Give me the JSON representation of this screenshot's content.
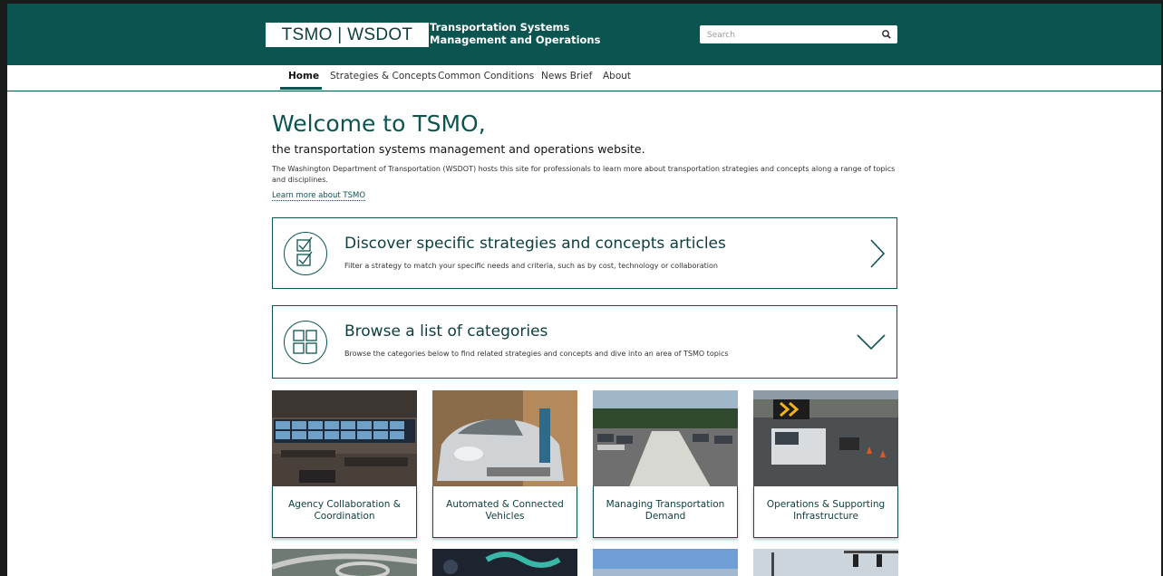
{
  "header": {
    "logo_text": "TSMO | WSDOT",
    "site_title_line1": "Transportation Systems",
    "site_title_line2": "Management and Operations",
    "search_placeholder": "Search",
    "brand_color": "#0c5450"
  },
  "nav": {
    "items": [
      {
        "label": "Home",
        "active": true
      },
      {
        "label": "Strategies & Concepts",
        "active": false
      },
      {
        "label": "Common Conditions",
        "active": false
      },
      {
        "label": "News Brief",
        "active": false
      },
      {
        "label": "About",
        "active": false
      }
    ]
  },
  "main": {
    "welcome": "Welcome to TSMO,",
    "subtitle": "the transportation systems management and operations website.",
    "intro": "The Washington Department of Transportation (WSDOT) hosts this site for professionals to learn more about transportation strategies and concepts along a range of topics and disciplines.",
    "learn_more": "Learn more about TSMO",
    "cards": [
      {
        "title": "Discover specific strategies and concepts articles",
        "desc": "Filter a strategy to match your specific needs and criteria, such as by cost, technology or collaboration",
        "icon": "checklist-icon",
        "chevron": "chevron-right-icon"
      },
      {
        "title": "Browse a list of categories",
        "desc": "Browse the categories below to find related strategies and concepts and dive into an area of TSMO topics",
        "icon": "grid-icon",
        "chevron": "chevron-down-icon"
      }
    ],
    "categories": [
      {
        "label": "Agency Collaboration & Coordination"
      },
      {
        "label": "Automated & Connected Vehicles"
      },
      {
        "label": "Managing Transportation Demand"
      },
      {
        "label": "Operations & Supporting Infrastructure"
      }
    ]
  }
}
